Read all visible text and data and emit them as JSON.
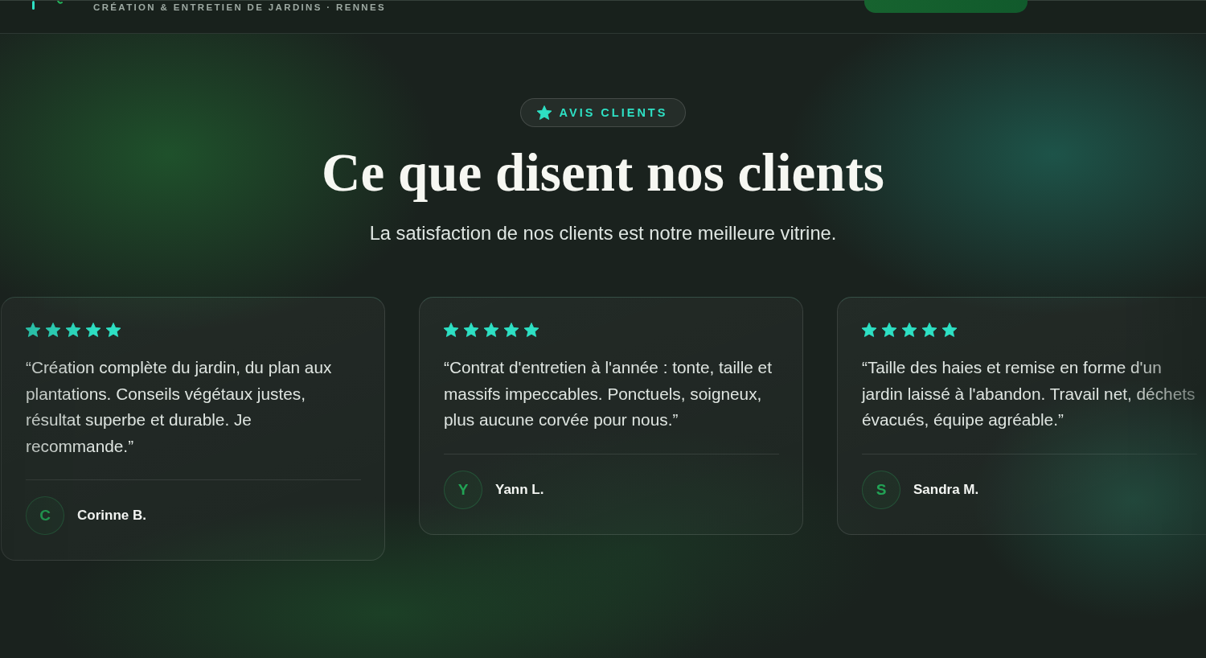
{
  "header": {
    "tagline": "CRÉATION & ENTRETIEN DE JARDINS · RENNES"
  },
  "section": {
    "badge": "AVIS CLIENTS",
    "title": "Ce que disent nos clients",
    "subtitle": "La satisfaction de nos clients est notre meilleure vitrine."
  },
  "testimonials": [
    {
      "stars": 5,
      "quote": "“Création complète du jardin, du plan aux plantations. Conseils végétaux justes, résultat superbe et durable. Je recommande.”",
      "initial": "C",
      "name": "Corinne B."
    },
    {
      "stars": 5,
      "quote": "“Contrat d'entretien à l'année : tonte, taille et massifs impeccables. Ponctuels, soigneux, plus aucune corvée pour nous.”",
      "initial": "Y",
      "name": "Yann L."
    },
    {
      "stars": 5,
      "quote": "“Taille des haies et remise en forme d'un jardin laissé à l'abandon. Travail net, déchets évacués, équipe agréable.”",
      "initial": "S",
      "name": "Sandra M."
    }
  ]
}
